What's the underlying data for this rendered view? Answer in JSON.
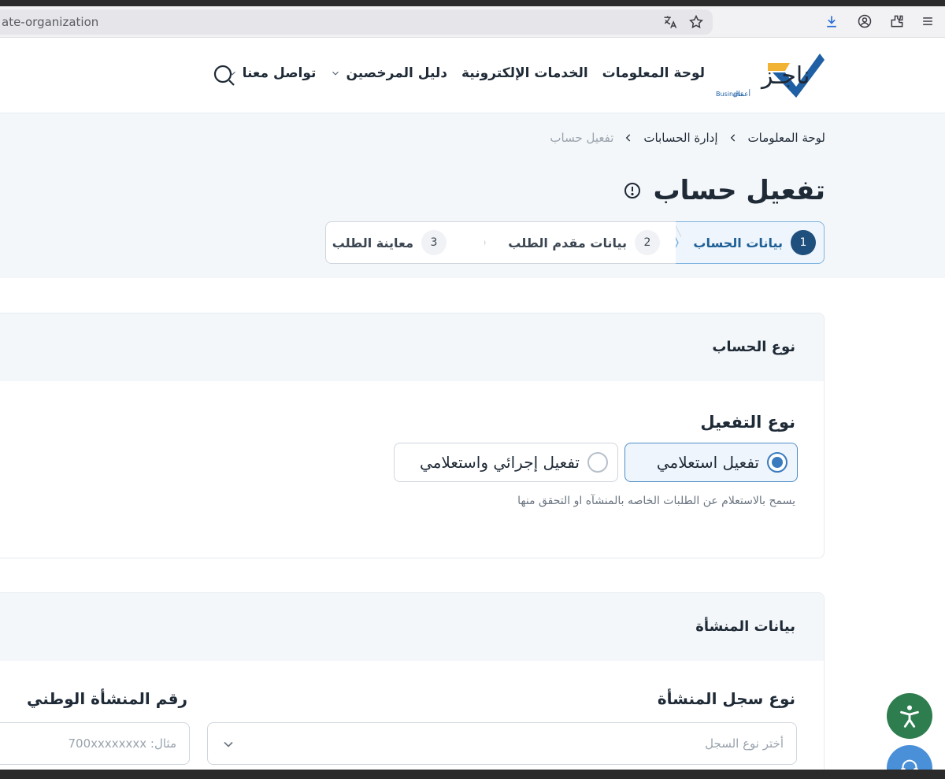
{
  "browser": {
    "url_fragment": "ate-organization",
    "icons": [
      "translate-icon",
      "star-icon",
      "download-icon",
      "account-icon",
      "extensions-icon",
      "menu-icon"
    ]
  },
  "header": {
    "logo_text": "ناجـز",
    "logo_sub_ar": "أعمال",
    "logo_sub_en": "Business",
    "nav": [
      {
        "label": "لوحة المعلومات",
        "dropdown": false
      },
      {
        "label": "الخدمات الإلكترونية",
        "dropdown": false
      },
      {
        "label": "دليل المرخصين",
        "dropdown": true
      },
      {
        "label": "تواصل معنا",
        "dropdown": true
      }
    ]
  },
  "breadcrumb": {
    "items": [
      "لوحة المعلومات",
      "إدارة الحسابات"
    ],
    "current": "تفعيل حساب"
  },
  "page": {
    "title": "تفعيل حساب"
  },
  "stepper": [
    {
      "num": "1",
      "label": "بيانات الحساب",
      "active": true
    },
    {
      "num": "2",
      "label": "بيانات مقدم الطلب",
      "active": false
    },
    {
      "num": "3",
      "label": "معاينة الطلب",
      "active": false
    }
  ],
  "account_type": {
    "section_title": "نوع الحساب",
    "field_label": "نوع التفعيل",
    "options": [
      {
        "label": "تفعيل استعلامي",
        "selected": true
      },
      {
        "label": "تفعيل إجرائي واستعلامي",
        "selected": false
      }
    ],
    "hint": "يسمح بالاستعلام عن الطلبات الخاصه بالمنشآه او التحقق منها"
  },
  "establishment": {
    "section_title": "بيانات المنشأة",
    "registry_type_label": "نوع سجل المنشأة",
    "registry_type_placeholder": "أختر نوع السجل",
    "national_number_label": "رقم المنشأة الوطني",
    "national_number_placeholder": "مثال: 700xxxxxxxx"
  },
  "colors": {
    "accent": "#1f4f7d",
    "selected_border": "#4f8fc8",
    "accessibility_fab": "#2e7d4f"
  }
}
